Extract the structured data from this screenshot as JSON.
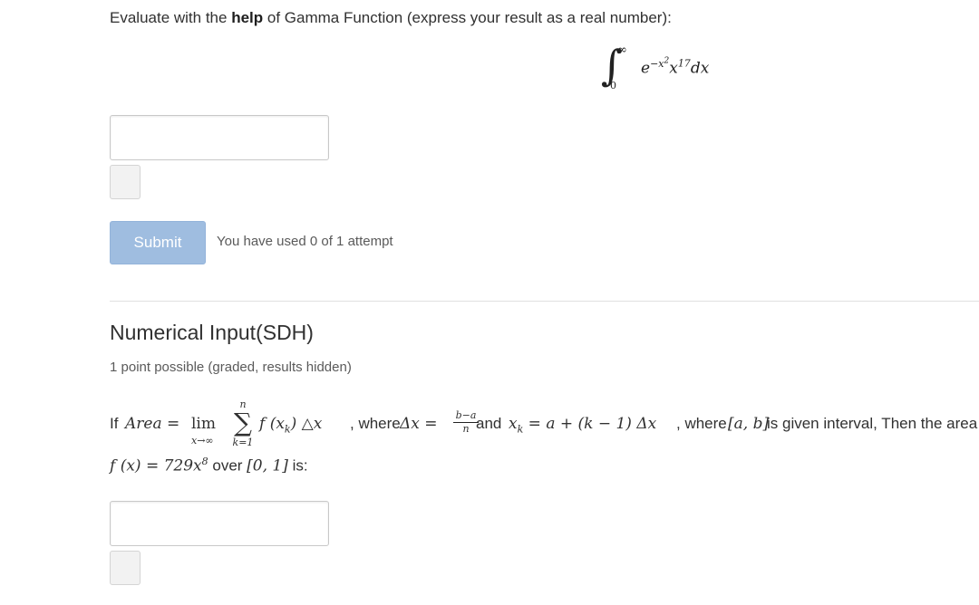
{
  "question1": {
    "prompt_before": "Evaluate with the ",
    "prompt_bold": "help",
    "prompt_after": " of Gamma Function (express your result as a real number):",
    "integral": {
      "sign": "∫",
      "upper": "∞",
      "lower": "0",
      "base": "e",
      "exponent": "−x",
      "exponent_power": "2",
      "factor": "x",
      "factor_power": "17",
      "differential": "dx"
    }
  },
  "submit": {
    "label": "Submit",
    "attempts": "You have used 0 of 1 attempt"
  },
  "problem2": {
    "title": "Numerical Input(SDH)",
    "points": "1 point possible (graded, results hidden)",
    "line1": {
      "if": "If ",
      "area": "Area =",
      "lim": "lim",
      "lim_sub": "x→∞",
      "sum_top": "n",
      "sum_sign": "∑",
      "sum_bot": "k=1",
      "summand": "f (x",
      "summand_sub": "k",
      "summand_tail": ") △x",
      "where1": ", where ",
      "delta": "Δx =",
      "frac_num": "b−a",
      "frac_den": "n",
      "and": "and ",
      "xk": "x",
      "xk_sub": "k",
      "xk_rhs": " = a + (k − 1) Δx",
      "where2": ", where ",
      "interval": "[a, b]",
      "tail": " is given interval, Then the area"
    },
    "line2": {
      "fx": "f (x) = 729x",
      "power": "8",
      "over": " over ",
      "interval": "[0, 1]",
      "is": " is:"
    }
  }
}
